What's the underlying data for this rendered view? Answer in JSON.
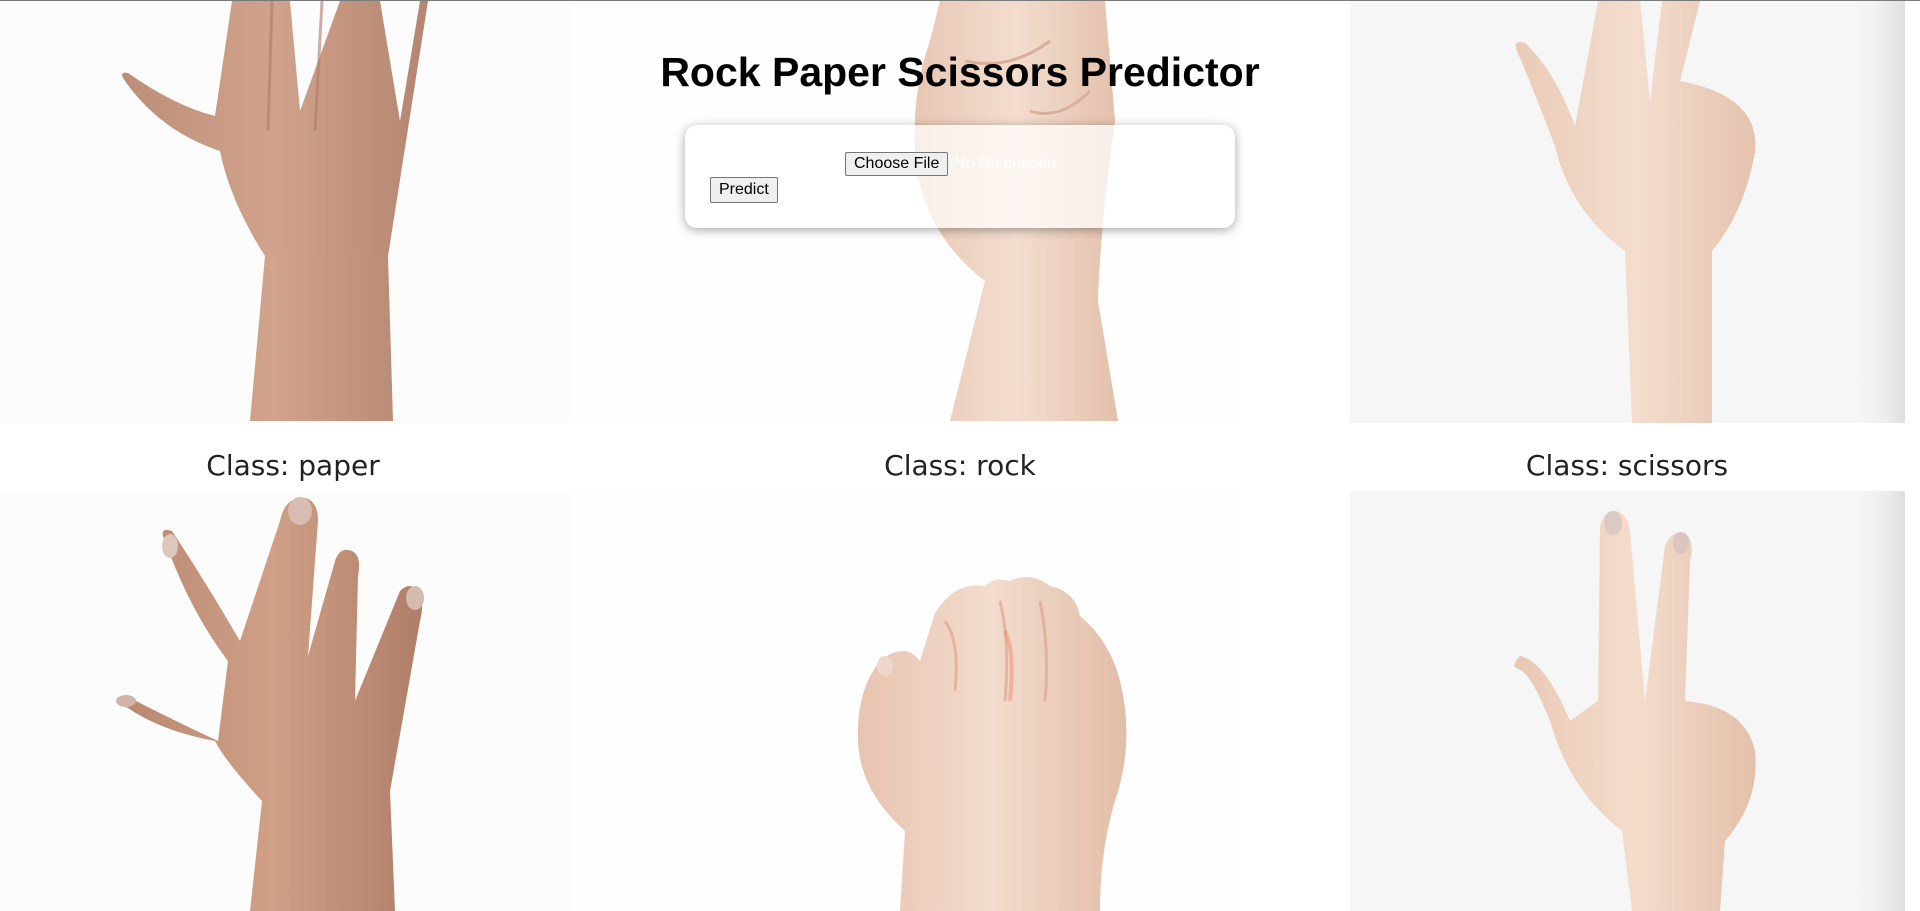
{
  "page": {
    "title": "Rock Paper Scissors Predictor"
  },
  "upload": {
    "choose_label": "Choose File",
    "file_status": "No file chosen",
    "predict_label": "Predict"
  },
  "samples": [
    {
      "caption": "Class: paper"
    },
    {
      "caption": "Class: rock"
    },
    {
      "caption": "Class: scissors"
    }
  ],
  "colors": {
    "skin_dark": "#c49279",
    "skin_light": "#ecc9b3",
    "skin_pale": "#f1d3c2",
    "caption": "#222222"
  }
}
